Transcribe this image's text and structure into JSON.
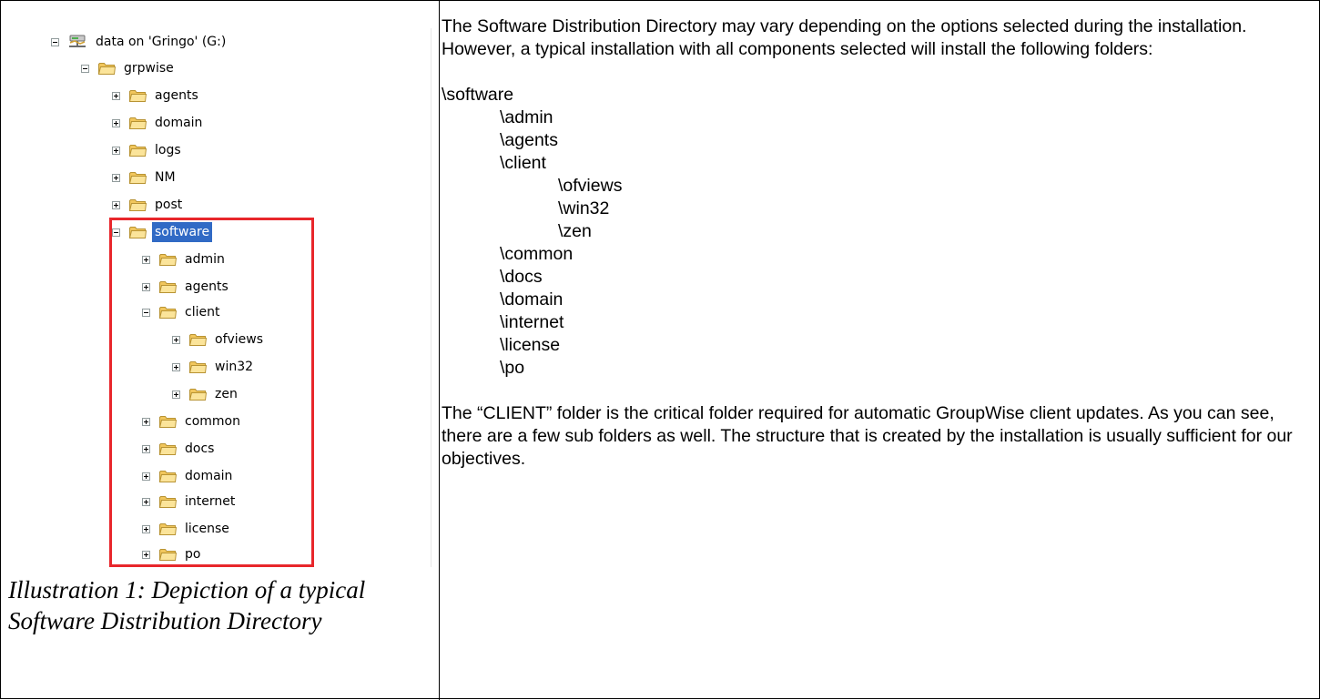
{
  "tree": {
    "drive": {
      "label": "data on 'Gringo' (G:)",
      "icon": "network-drive-icon"
    },
    "grpwise": "grpwise",
    "grpwise_children": [
      "agents",
      "domain",
      "logs",
      "NM",
      "post"
    ],
    "software": "software",
    "software_children": {
      "admin": "admin",
      "agents": "agents",
      "client": "client",
      "client_children": [
        "ofviews",
        "win32",
        "zen"
      ],
      "rest": [
        "common",
        "docs",
        "domain",
        "internet",
        "license",
        "po"
      ]
    }
  },
  "caption": {
    "prefix": "Illustration 1",
    "text": ": Depiction of a typical Software Distribution Directory"
  },
  "body": {
    "intro": "The Software Distribution Directory may vary depending on the options selected during the installation. However, a typical installation with all components selected will install the following folders:",
    "paths": {
      "root": "\\software",
      "admin": "\\admin",
      "agents": "\\agents",
      "client": "\\client",
      "ofviews": "\\ofviews",
      "win32": "\\win32",
      "zen": "\\zen",
      "common": "\\common",
      "docs": "\\docs",
      "domain": "\\domain",
      "internet": "\\internet",
      "license": "\\license",
      "po": "\\po"
    },
    "closing": "The “CLIENT” folder is the critical folder required for automatic GroupWise client updates. As you can see, there are a few sub folders as well. The structure that is created by the installation is usually sufficient for our objectives."
  },
  "colors": {
    "highlight_box": "#e8262b",
    "selection": "#316ac5",
    "folder_fill": "#f9dd86",
    "folder_stroke": "#c3a141"
  }
}
